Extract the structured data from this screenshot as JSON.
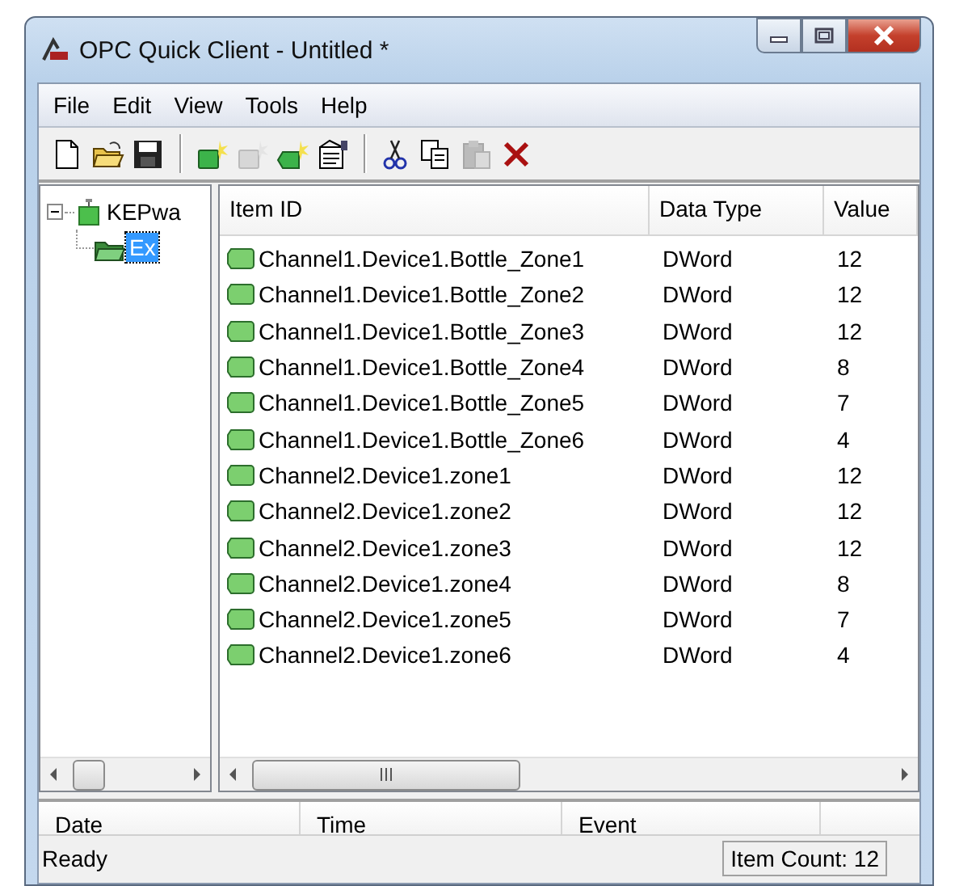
{
  "window": {
    "title": "OPC Quick Client - Untitled *"
  },
  "menu": [
    "File",
    "Edit",
    "View",
    "Tools",
    "Help"
  ],
  "toolbar": [
    [
      {
        "kind": "new",
        "disabled": false
      },
      {
        "kind": "open",
        "disabled": false
      },
      {
        "kind": "save",
        "disabled": false
      }
    ],
    [
      {
        "kind": "new-server",
        "disabled": false
      },
      {
        "kind": "new-group",
        "disabled": true
      },
      {
        "kind": "new-item",
        "disabled": false
      },
      {
        "kind": "properties",
        "disabled": false
      }
    ],
    [
      {
        "kind": "cut",
        "disabled": false
      },
      {
        "kind": "copy",
        "disabled": false
      },
      {
        "kind": "paste",
        "disabled": true
      },
      {
        "kind": "delete",
        "disabled": false
      }
    ]
  ],
  "tree": [
    {
      "label": "KEPwa",
      "expanded": true,
      "selected": false,
      "children": [
        {
          "label": "Ex",
          "selected": true
        }
      ]
    }
  ],
  "table": {
    "columns": [
      "Item ID",
      "Data Type",
      "Value"
    ],
    "rows": [
      [
        "Channel1.Device1.Bottle_Zone1",
        "DWord",
        "12"
      ],
      [
        "Channel1.Device1.Bottle_Zone2",
        "DWord",
        "12"
      ],
      [
        "Channel1.Device1.Bottle_Zone3",
        "DWord",
        "12"
      ],
      [
        "Channel1.Device1.Bottle_Zone4",
        "DWord",
        "8"
      ],
      [
        "Channel1.Device1.Bottle_Zone5",
        "DWord",
        "7"
      ],
      [
        "Channel1.Device1.Bottle_Zone6",
        "DWord",
        "4"
      ],
      [
        "Channel2.Device1.zone1",
        "DWord",
        "12"
      ],
      [
        "Channel2.Device1.zone2",
        "DWord",
        "12"
      ],
      [
        "Channel2.Device1.zone3",
        "DWord",
        "12"
      ],
      [
        "Channel2.Device1.zone4",
        "DWord",
        "8"
      ],
      [
        "Channel2.Device1.zone5",
        "DWord",
        "7"
      ],
      [
        "Channel2.Device1.zone6",
        "DWord",
        "4"
      ]
    ]
  },
  "event_log": {
    "columns": [
      "Date",
      "Time",
      "Event"
    ]
  },
  "status_bar": {
    "message": "Ready",
    "item_count": "Item Count: 12"
  }
}
